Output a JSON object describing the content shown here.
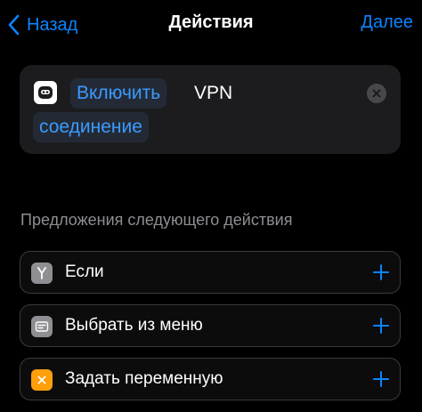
{
  "nav": {
    "back_label": "Назад",
    "title": "Действия",
    "next_label": "Далее"
  },
  "action": {
    "app_icon": "vpn-bot-icon",
    "verb": "Включить",
    "word": "VPN",
    "object": "соединение",
    "clear_icon": "clear-icon"
  },
  "suggestions": {
    "header": "Предложения следующего действия",
    "items": [
      {
        "label": "Если",
        "icon": "branch-icon",
        "icon_color": "#8e8e93"
      },
      {
        "label": "Выбрать из меню",
        "icon": "menu-icon",
        "icon_color": "#8e8e93"
      },
      {
        "label": "Задать переменную",
        "icon": "variable-x-icon",
        "icon_color": "#ff9f0a"
      }
    ],
    "add_icon": "plus-icon"
  },
  "colors": {
    "accent": "#0a84ff",
    "background": "#000000",
    "card": "#1c1c1e",
    "secondary_text": "#8e8e93"
  }
}
